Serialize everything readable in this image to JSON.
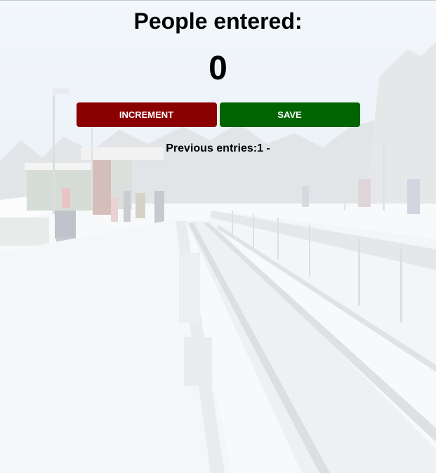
{
  "header": {
    "title": "People entered:"
  },
  "counter": {
    "value": "0"
  },
  "buttons": {
    "increment_label": "INCREMENT",
    "save_label": "SAVE"
  },
  "entries": {
    "label": "Previous entries:",
    "text": "1 -"
  },
  "colors": {
    "increment": "#8b0000",
    "save": "#006400"
  }
}
